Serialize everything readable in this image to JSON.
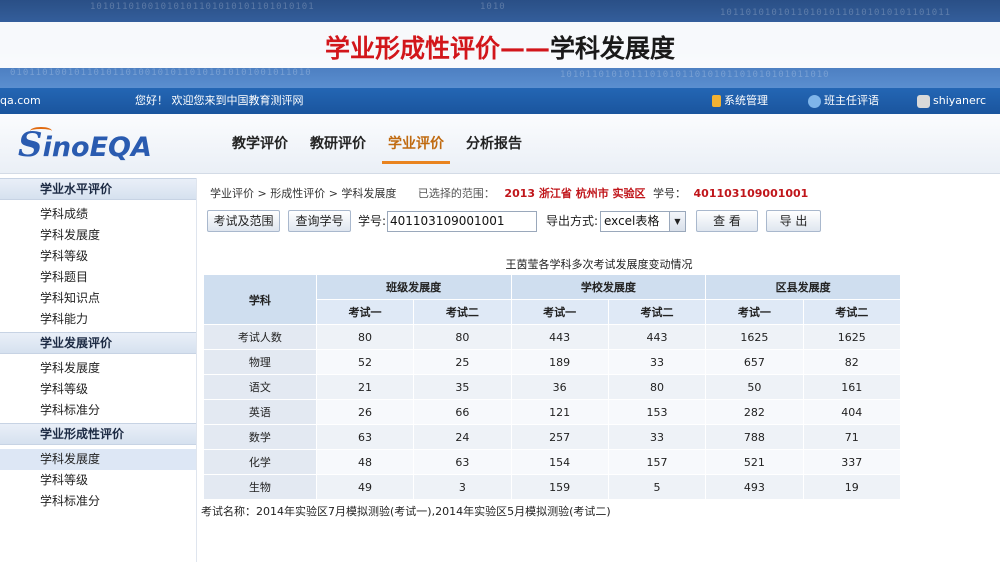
{
  "slide": {
    "title_part1": "学业形成性评价——",
    "title_part2": "学科发展度",
    "binary_lines": [
      "1010",
      "10101101001010101101010101101010101",
      "01011010010110101101001010110101010101001011010",
      "101011010101110101011010101101010101011010",
      "101101010101101010110101010101101011"
    ]
  },
  "topbar": {
    "site": "qa.com",
    "welcome": "您好！  欢迎您来到中国教育测评网",
    "links": [
      {
        "label": "系统管理",
        "icon": "key-icon",
        "color": "#f2b233"
      },
      {
        "label": "班主任评语",
        "icon": "globe-icon",
        "color": "#7fb5ea"
      },
      {
        "label": "shiyanerc",
        "icon": "user-icon",
        "color": "#d9d9d9"
      }
    ]
  },
  "logo": {
    "first": "S",
    "rest": "inoEQA"
  },
  "nav": [
    {
      "label": "教学评价",
      "active": false
    },
    {
      "label": "教研评价",
      "active": false
    },
    {
      "label": "学业评价",
      "active": true
    },
    {
      "label": "分析报告",
      "active": false
    }
  ],
  "sidebar": {
    "groups": [
      {
        "header": "学业水平评价",
        "items": [
          "学科成绩",
          "学科发展度",
          "学科等级",
          "学科题目",
          "学科知识点",
          "学科能力"
        ]
      },
      {
        "header": "学业发展评价",
        "items": [
          "学科发展度",
          "学科等级",
          "学科标准分"
        ]
      },
      {
        "header": "学业形成性评价",
        "items": [
          "学科发展度",
          "学科等级",
          "学科标准分"
        ]
      }
    ]
  },
  "breadcrumb": {
    "path": "学业评价 > 形成性评价 > 学科发展度",
    "scope_label": "已选择的范围：",
    "scope_value": "2013  浙江省  杭州市  实验区",
    "student_label": "学号：",
    "student_id": "401103109001001"
  },
  "toolbar": {
    "exam_scope_button": "考试及范围",
    "query_id_button": "查询学号",
    "id_label": "学号:",
    "id_value": "401103109001001",
    "export_label": "导出方式:",
    "export_option": "excel表格",
    "view_button": "查 看",
    "export_button": "导 出"
  },
  "table": {
    "title": "王茵莹各学科多次考试发展度变动情况",
    "subject_header": "学科",
    "group_headers": [
      "班级发展度",
      "学校发展度",
      "区县发展度"
    ],
    "sub_headers": [
      "考试一",
      "考试二",
      "考试一",
      "考试二",
      "考试一",
      "考试二"
    ],
    "rows": [
      {
        "subject": "考试人数",
        "values": [
          "80",
          "80",
          "443",
          "443",
          "1625",
          "1625"
        ]
      },
      {
        "subject": "物理",
        "values": [
          "52",
          "25",
          "189",
          "33",
          "657",
          "82"
        ]
      },
      {
        "subject": "语文",
        "values": [
          "21",
          "35",
          "36",
          "80",
          "50",
          "161"
        ]
      },
      {
        "subject": "英语",
        "values": [
          "26",
          "66",
          "121",
          "153",
          "282",
          "404"
        ]
      },
      {
        "subject": "数学",
        "values": [
          "63",
          "24",
          "257",
          "33",
          "788",
          "71"
        ]
      },
      {
        "subject": "化学",
        "values": [
          "48",
          "63",
          "154",
          "157",
          "521",
          "337"
        ]
      },
      {
        "subject": "生物",
        "values": [
          "49",
          "3",
          "159",
          "5",
          "493",
          "19"
        ]
      }
    ]
  },
  "note": "考试名称：2014年实验区7月模拟测验(考试一),2014年实验区5月模拟测验(考试二)"
}
